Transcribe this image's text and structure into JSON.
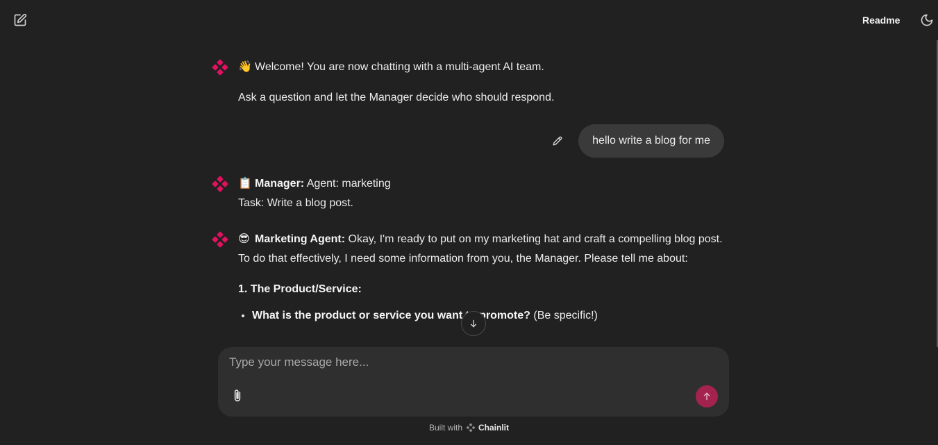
{
  "header": {
    "new_chat_icon": "edit-square-icon",
    "readme_label": "Readme",
    "theme_icon": "moon-icon"
  },
  "colors": {
    "background": "#212121",
    "accent": "#e0115f",
    "send_button": "#a3234e",
    "user_bubble": "#3a3a3a",
    "composer": "#2f2f2f"
  },
  "messages": {
    "welcome": {
      "emoji": "👋",
      "line1": "Welcome! You are now chatting with a multi-agent AI team.",
      "line2": "Ask a question and let the Manager decide who should respond."
    },
    "user": {
      "text": "hello write a blog for me"
    },
    "manager": {
      "emoji": "📋",
      "name": "Manager:",
      "line1": " Agent: marketing",
      "line2": "Task: Write a blog post."
    },
    "marketing": {
      "emoji": "😎",
      "name": "Marketing Agent:",
      "text": " Okay, I'm ready to put on my marketing hat and craft a compelling blog post. To do that effectively, I need some information from you, the Manager.  Please tell me about:",
      "section_heading": "1. The Product/Service:",
      "bullet1_bold": "What is the product or service you want to promote?",
      "bullet1_rest": " (Be specific!)"
    }
  },
  "composer": {
    "placeholder": "Type your message here...",
    "value": ""
  },
  "footer": {
    "built_with": "Built with",
    "brand": "Chainlit"
  }
}
